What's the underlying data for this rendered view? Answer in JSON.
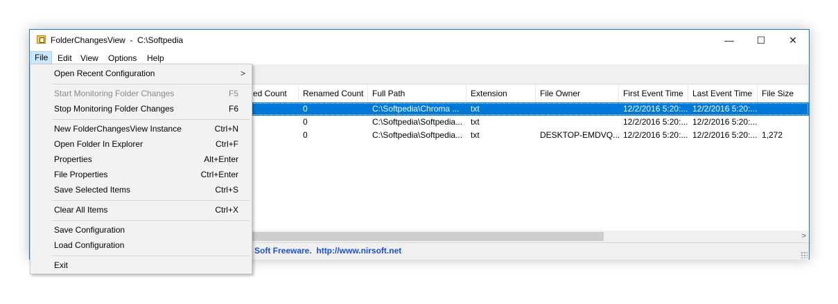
{
  "window": {
    "title": "FolderChangesView  -  C:\\Softpedia",
    "controls": {
      "minimize": "—",
      "maximize": "☐",
      "close": "✕"
    }
  },
  "menubar": [
    {
      "label": "File"
    },
    {
      "label": "Edit"
    },
    {
      "label": "View"
    },
    {
      "label": "Options"
    },
    {
      "label": "Help"
    }
  ],
  "columns": [
    {
      "label": "ed Count"
    },
    {
      "label": "Renamed Count"
    },
    {
      "label": "Full Path"
    },
    {
      "label": "Extension"
    },
    {
      "label": "File Owner"
    },
    {
      "label": "First Event Time"
    },
    {
      "label": "Last Event Time"
    },
    {
      "label": "File Size"
    }
  ],
  "rows": [
    {
      "selected": true,
      "cells": [
        "",
        "0",
        "C:\\Softpedia\\Chroma ...",
        "txt",
        "",
        "12/2/2016 5:20:...",
        "12/2/2016 5:20:...",
        ""
      ]
    },
    {
      "selected": false,
      "cells": [
        "",
        "0",
        "C:\\Softpedia\\Softpedia...",
        "txt",
        "",
        "12/2/2016 5:20:...",
        "12/2/2016 5:20:...",
        ""
      ]
    },
    {
      "selected": false,
      "cells": [
        "",
        "0",
        "C:\\Softpedia\\Softpedia...",
        "txt",
        "DESKTOP-EMDVQ...",
        "12/2/2016 5:20:...",
        "12/2/2016 5:20:...",
        "1,272"
      ]
    }
  ],
  "scroll_right_arrow": ">",
  "status": {
    "text": "Soft Freeware.  http://www.nirsoft.net"
  },
  "file_menu": {
    "items": [
      {
        "label": "Open Recent Configuration",
        "shortcut": "",
        "submenu_arrow": ">",
        "disabled": false
      },
      {
        "separator": true
      },
      {
        "label": "Start Monitoring Folder Changes",
        "shortcut": "F5",
        "disabled": true
      },
      {
        "label": "Stop Monitoring Folder Changes",
        "shortcut": "F6",
        "disabled": false
      },
      {
        "separator": true
      },
      {
        "label": "New FolderChangesView Instance",
        "shortcut": "Ctrl+N",
        "disabled": false
      },
      {
        "label": "Open Folder In Explorer",
        "shortcut": "Ctrl+F",
        "disabled": false
      },
      {
        "label": "Properties",
        "shortcut": "Alt+Enter",
        "disabled": false
      },
      {
        "label": "File Properties",
        "shortcut": "Ctrl+Enter",
        "disabled": false
      },
      {
        "label": "Save Selected Items",
        "shortcut": "Ctrl+S",
        "disabled": false
      },
      {
        "separator": true
      },
      {
        "label": "Clear All Items",
        "shortcut": "Ctrl+X",
        "disabled": false
      },
      {
        "separator": true
      },
      {
        "label": "Save Configuration",
        "shortcut": "",
        "disabled": false
      },
      {
        "label": "Load Configuration",
        "shortcut": "",
        "disabled": false
      },
      {
        "separator": true
      },
      {
        "label": "Exit",
        "shortcut": "",
        "disabled": false
      }
    ]
  },
  "colors": {
    "selection": "#0078d7",
    "window_border": "#1979ca",
    "link": "#1a4fd6"
  }
}
